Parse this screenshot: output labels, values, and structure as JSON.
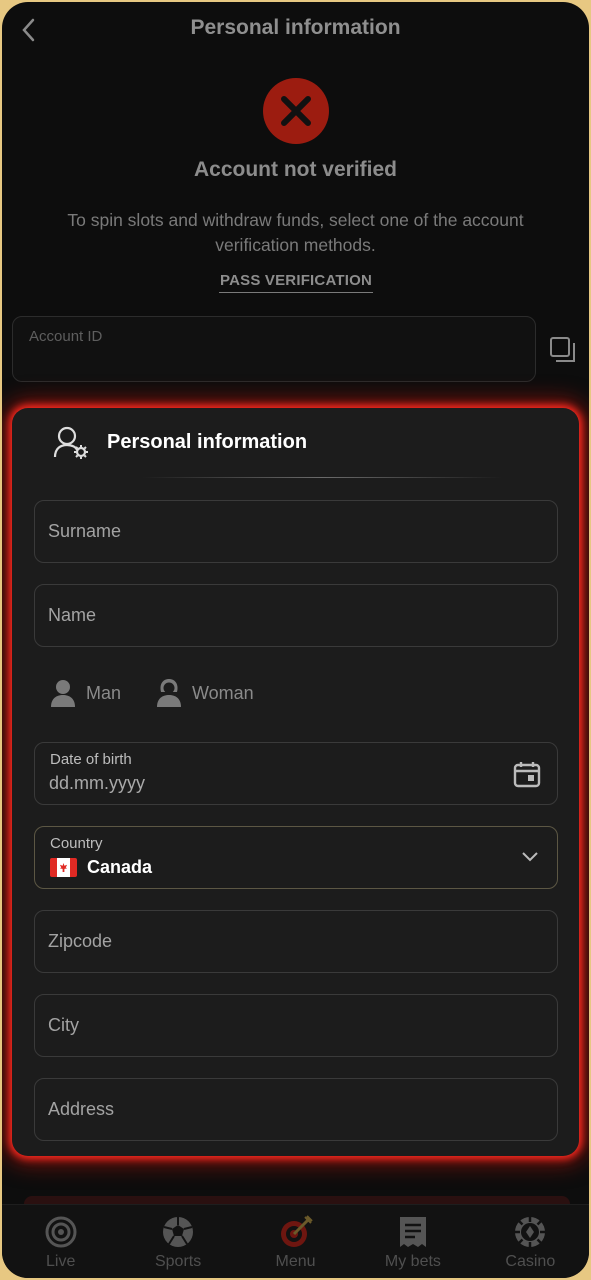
{
  "header": {
    "title": "Personal information"
  },
  "verification": {
    "status_title": "Account not verified",
    "message": "To spin slots and withdraw funds, select one of the account verification methods.",
    "pass_link": "PASS VERIFICATION"
  },
  "account": {
    "label": "Account ID",
    "value": ""
  },
  "card": {
    "title": "Personal information",
    "surname_placeholder": "Surname",
    "name_placeholder": "Name",
    "gender": {
      "man": "Man",
      "woman": "Woman"
    },
    "dob": {
      "label": "Date of birth",
      "value": "dd.mm.yyyy"
    },
    "country": {
      "label": "Country",
      "value": "Canada"
    },
    "zipcode_placeholder": "Zipcode",
    "city_placeholder": "City",
    "address_placeholder": "Address"
  },
  "tabs": [
    {
      "label": "Live",
      "icon": "live-icon"
    },
    {
      "label": "Sports",
      "icon": "soccer-ball-icon"
    },
    {
      "label": "Menu",
      "icon": "target-dart-icon"
    },
    {
      "label": "My bets",
      "icon": "receipt-icon"
    },
    {
      "label": "Casino",
      "icon": "casino-chip-icon"
    }
  ],
  "colors": {
    "accent_red": "#ff2a20",
    "error_circle": "#9c1c10",
    "background": "#0d0d0d",
    "card": "#1c1c1c"
  }
}
